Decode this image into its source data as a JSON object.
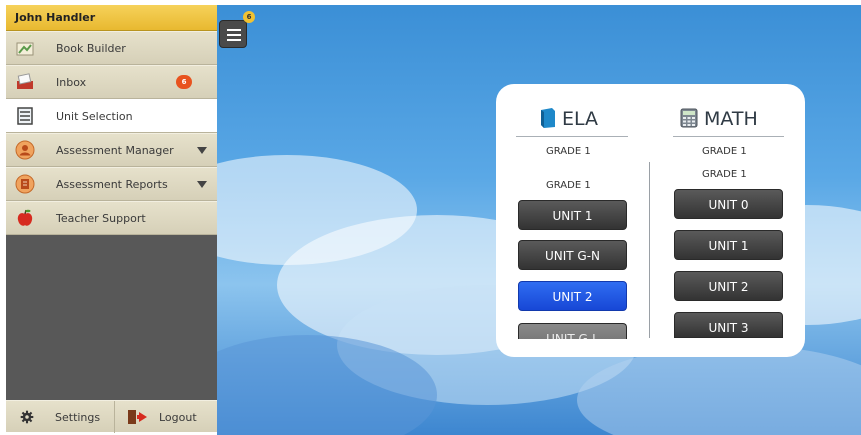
{
  "user": {
    "name": "John Handler"
  },
  "sidebar": {
    "items": [
      {
        "label": "Book Builder",
        "icon": "book-builder-icon"
      },
      {
        "label": "Inbox",
        "icon": "inbox-icon",
        "badge": "6"
      },
      {
        "label": "Unit Selection",
        "icon": "unit-selection-icon",
        "active": true
      },
      {
        "label": "Assessment Manager",
        "icon": "assessment-manager-icon",
        "expandable": true
      },
      {
        "label": "Assessment Reports",
        "icon": "assessment-reports-icon",
        "expandable": true
      },
      {
        "label": "Teacher Support",
        "icon": "apple-icon"
      }
    ],
    "settings_label": "Settings",
    "logout_label": "Logout"
  },
  "menu_button": {
    "badge": "6",
    "icon": "hamburger-menu-icon"
  },
  "units_panel": {
    "ela": {
      "title": "ELA",
      "icon": "book-icon",
      "grade_header": "GRADE 1",
      "grade_sub": "GRADE 1",
      "units": [
        "UNIT 1",
        "UNIT G-N",
        "UNIT 2",
        "UNIT G-L"
      ],
      "selected_unit": "UNIT 2"
    },
    "math": {
      "title": "MATH",
      "icon": "calculator-icon",
      "grade_header": "GRADE 1",
      "grade_sub": "GRADE 1",
      "units": [
        "UNIT 0",
        "UNIT 1",
        "UNIT 2",
        "UNIT 3"
      ]
    }
  },
  "colors": {
    "header_yellow": "#f1c232",
    "sidebar_bg": "#585858",
    "menu_item_bg": "#e0dbc4",
    "badge_orange": "#e8531f",
    "selected_unit": "#1f56e4",
    "unit_button": "#444444",
    "sky_blue": "#4a9ade"
  }
}
